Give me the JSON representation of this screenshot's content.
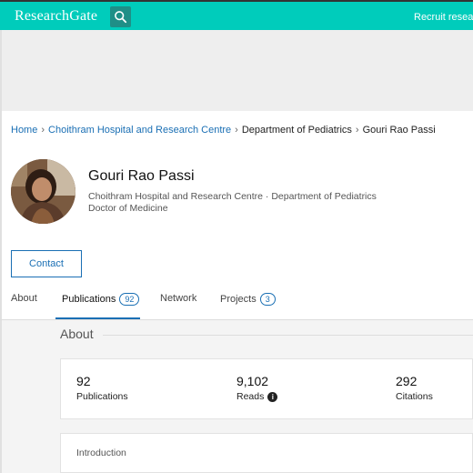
{
  "header": {
    "logo": "ResearchGate",
    "search_icon": "search-icon",
    "recruit_text": "Recruit researc"
  },
  "breadcrumb": {
    "items": [
      "Home",
      "Choithram Hospital and Research Centre",
      "Department of Pediatrics",
      "Gouri Rao Passi"
    ]
  },
  "profile": {
    "name": "Gouri Rao Passi",
    "affiliation": "Choithram Hospital and Research Centre · Department of Pediatrics",
    "degree": "Doctor of Medicine",
    "contact_label": "Contact"
  },
  "tabs": [
    {
      "label": "About",
      "badge": ""
    },
    {
      "label": "Publications",
      "badge": "92"
    },
    {
      "label": "Network",
      "badge": ""
    },
    {
      "label": "Projects",
      "badge": "3"
    }
  ],
  "about": {
    "heading": "About",
    "stats": [
      {
        "value": "92",
        "label": "Publications"
      },
      {
        "value": "9,102",
        "label": "Reads"
      },
      {
        "value": "292",
        "label": "Citations"
      }
    ],
    "intro_label": "Introduction"
  },
  "colors": {
    "brand": "#00ccbb",
    "link": "#1a6fb4"
  }
}
